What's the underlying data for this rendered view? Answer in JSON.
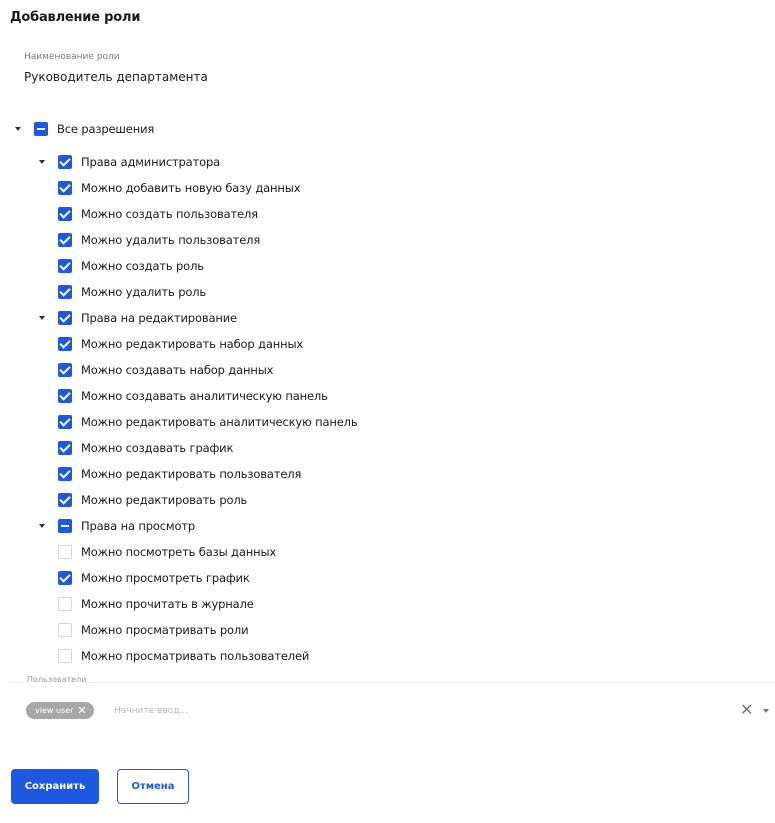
{
  "title": "Добавление роли",
  "role_name": {
    "label": "Наименование роли",
    "value": "Руководитель департамента"
  },
  "permissions": {
    "all": {
      "label": "Все разрешения",
      "state": "indeterminate"
    },
    "groups": [
      {
        "label": "Права администратора",
        "state": "checked",
        "items": [
          {
            "label": "Можно добавить новую базу данных",
            "state": "checked"
          },
          {
            "label": "Можно создать пользователя",
            "state": "checked"
          },
          {
            "label": "Можно удалить пользователя",
            "state": "checked"
          },
          {
            "label": "Можно создать роль",
            "state": "checked"
          },
          {
            "label": "Можно удалить роль",
            "state": "checked"
          }
        ]
      },
      {
        "label": "Права на редактирование",
        "state": "checked",
        "items": [
          {
            "label": "Можно редактировать набор данных",
            "state": "checked"
          },
          {
            "label": "Можно создавать набор данных",
            "state": "checked"
          },
          {
            "label": "Можно создавать аналитическую панель",
            "state": "checked"
          },
          {
            "label": "Можно редактировать аналитическую панель",
            "state": "checked"
          },
          {
            "label": "Можно создавать график",
            "state": "checked"
          },
          {
            "label": "Можно редактировать пользователя",
            "state": "checked"
          },
          {
            "label": "Можно редактировать роль",
            "state": "checked"
          }
        ]
      },
      {
        "label": "Права на просмотр",
        "state": "indeterminate",
        "items": [
          {
            "label": "Можно посмотреть базы данных",
            "state": "unchecked"
          },
          {
            "label": "Можно просмотреть график",
            "state": "checked"
          },
          {
            "label": "Можно прочитать в журнале",
            "state": "unchecked"
          },
          {
            "label": "Можно просматривать роли",
            "state": "unchecked"
          },
          {
            "label": "Можно просматривать пользователей",
            "state": "unchecked"
          }
        ]
      }
    ]
  },
  "users": {
    "label": "Пользователи",
    "chips": [
      "view user"
    ],
    "placeholder": "Начните ввод..."
  },
  "buttons": {
    "save": "Сохранить",
    "cancel": "Отмена"
  },
  "colors": {
    "accent": "#1f58e0",
    "chip": "#a7a7a7"
  },
  "icons": {
    "chip_remove": "close-icon",
    "clear": "clear-icon",
    "dropdown": "chevron-down-icon",
    "expand": "caret-down-icon"
  }
}
